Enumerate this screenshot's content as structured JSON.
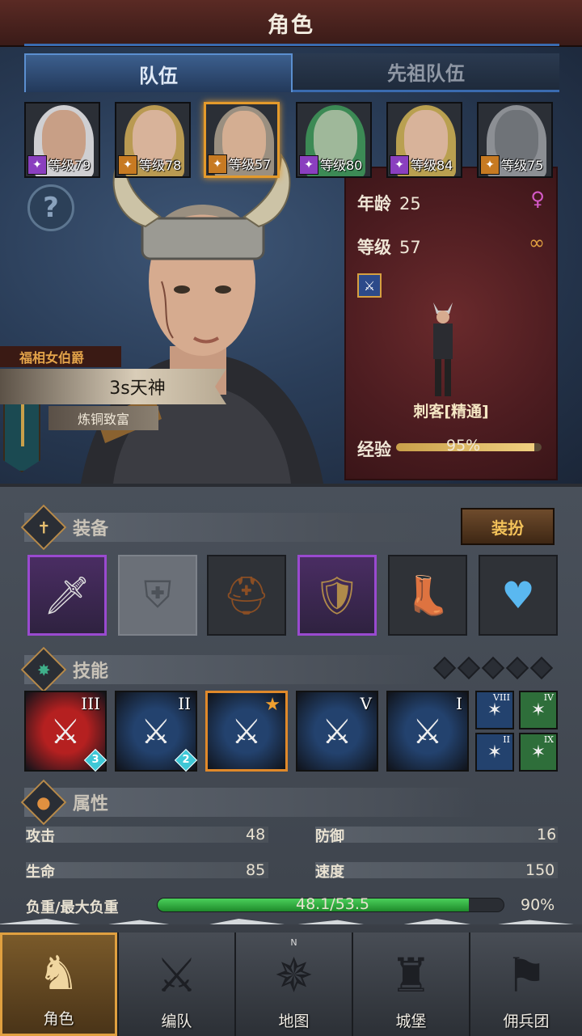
{
  "header": {
    "title": "角色"
  },
  "tabs": {
    "team": "队伍",
    "ancestor_team": "先祖队伍"
  },
  "team": [
    {
      "level_label": "等级79",
      "class_color": "#8a3fbf",
      "hair_color": "#cfcfd2",
      "skin": "#c89f86"
    },
    {
      "level_label": "等级78",
      "class_color": "#c77a22",
      "hair_color": "#b99a52",
      "skin": "#d8b39a"
    },
    {
      "level_label": "等级57",
      "class_color": "#c77a22",
      "hair_color": "#9a8f80",
      "skin": "#d4ae92",
      "selected": true
    },
    {
      "level_label": "等级80",
      "class_color": "#8a3fbf",
      "hair_color": "#3c8a55",
      "skin": "#9fb89a"
    },
    {
      "level_label": "等级84",
      "class_color": "#8a3fbf",
      "hair_color": "#b9a050",
      "skin": "#d8b39a"
    },
    {
      "level_label": "等级75",
      "class_color": "#c77a22",
      "hair_color": "#8c8f94",
      "skin": "#6f7378"
    }
  ],
  "hero": {
    "nobility": "福相女伯爵",
    "name": "3s天神",
    "motto": "炼铜致富"
  },
  "info_card": {
    "age_label": "年龄",
    "age": "25",
    "level_label": "等级",
    "level": "57",
    "class_name": "刺客[精通]",
    "exp_label": "经验",
    "exp_percent": "95%",
    "exp_fraction": 0.95,
    "gender_icon": "♀",
    "ring_icon": "∞"
  },
  "equipment": {
    "title": "装备",
    "dress_button": "装扮",
    "slots": [
      "sword-icon",
      "shield-slot-empty-icon",
      "helmet-icon",
      "armor-icon",
      "boots-icon",
      "amulet-icon"
    ]
  },
  "skills": {
    "title": "技能",
    "main": [
      {
        "tier": "III",
        "count": "3",
        "bg": "#b52020"
      },
      {
        "tier": "II",
        "count": "2",
        "bg": "#23426e"
      },
      {
        "tier": "",
        "count": "",
        "bg": "#23426e",
        "starred": true
      },
      {
        "tier": "V",
        "count": "",
        "bg": "#23426e"
      },
      {
        "tier": "I",
        "count": "",
        "bg": "#23426e"
      }
    ],
    "mini": [
      {
        "tier": "VIII",
        "bg": "#23426e"
      },
      {
        "tier": "IV",
        "bg": "#2e6e3a"
      },
      {
        "tier": "II",
        "bg": "#23426e"
      },
      {
        "tier": "IX",
        "bg": "#2e6e3a"
      }
    ]
  },
  "attributes": {
    "title": "属性",
    "attack_label": "攻击",
    "attack": "48",
    "defense_label": "防御",
    "defense": "16",
    "hp_label": "生命",
    "hp": "85",
    "speed_label": "速度",
    "speed": "150",
    "load_label": "负重/最大负重",
    "load": "48.1/53.5",
    "load_percent": "90%",
    "load_fraction": 0.9
  },
  "nav": [
    {
      "label": "角色",
      "icon": "knight-icon",
      "active": true
    },
    {
      "label": "编队",
      "icon": "squad-icon"
    },
    {
      "label": "地图",
      "icon": "compass-icon"
    },
    {
      "label": "城堡",
      "icon": "castle-icon"
    },
    {
      "label": "佣兵团",
      "icon": "mercenary-icon"
    }
  ],
  "nav_compass_letter": "N"
}
